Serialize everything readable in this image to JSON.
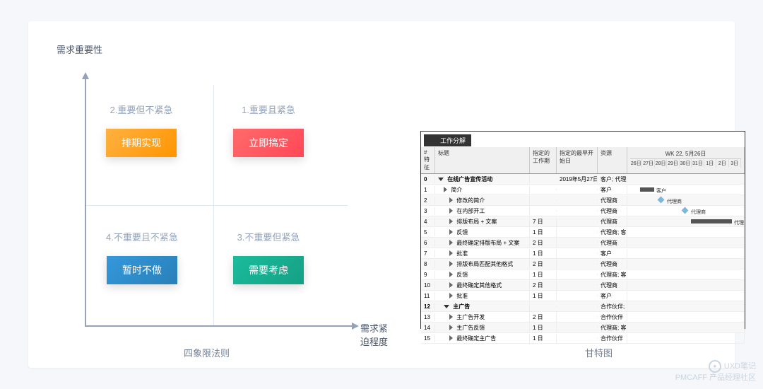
{
  "left": {
    "y_axis": "需求重要性",
    "x_axis": "需求紧迫程度",
    "caption": "四象限法则",
    "q1": {
      "label": "1.重要且紧急",
      "action": "立即搞定"
    },
    "q2": {
      "label": "2.重要但不紧急",
      "action": "排期实现"
    },
    "q3": {
      "label": "3.不重要但紧急",
      "action": "需要考虑"
    },
    "q4": {
      "label": "4.不重要且不紧急",
      "action": "暂时不做"
    }
  },
  "right": {
    "caption": "甘特图",
    "toolbar": "工作分解",
    "columns": {
      "idx": "# 特征",
      "title": "标题",
      "assigned": "指定的工作期",
      "start": "指定的最早开始日",
      "resource": "资源"
    },
    "week": "WK 22, 5月26日",
    "days": [
      "26日",
      "27日",
      "28日",
      "29日",
      "30日",
      "31日",
      "1日",
      "2日",
      "3日"
    ],
    "rows": [
      {
        "n": "0",
        "t": "在线广告宣传活动",
        "a": "",
        "b": "2019年5月27日",
        "r": "客户; 代理",
        "bold": true,
        "lvl": 0
      },
      {
        "n": "1",
        "t": "简介",
        "a": "",
        "b": "",
        "r": "客户",
        "lvl": 1,
        "bar": {
          "x": 18,
          "w": 20,
          "lbl": "客户"
        }
      },
      {
        "n": "2",
        "t": "修改的简介",
        "a": "",
        "b": "",
        "r": "代理商",
        "lvl": 2,
        "di": 44,
        "blbl": "代理商"
      },
      {
        "n": "3",
        "t": "在内部开工",
        "a": "",
        "b": "",
        "r": "代理商",
        "lvl": 2,
        "di": 78,
        "blbl": "代理商"
      },
      {
        "n": "4",
        "t": "排版布局 + 文案",
        "a": "7 日",
        "b": "",
        "r": "代理商",
        "lvl": 2,
        "bar": {
          "x": 90,
          "w": 58,
          "lbl": "代理商"
        }
      },
      {
        "n": "5",
        "t": "反馈",
        "a": "1 日",
        "b": "",
        "r": "代理商; 客",
        "lvl": 2
      },
      {
        "n": "6",
        "t": "最终确定排版布局 + 文案",
        "a": "2 日",
        "b": "",
        "r": "代理商",
        "lvl": 2
      },
      {
        "n": "7",
        "t": "批准",
        "a": "1 日",
        "b": "",
        "r": "客户",
        "lvl": 2
      },
      {
        "n": "8",
        "t": "排版布局匹配其他格式",
        "a": "2 日",
        "b": "",
        "r": "代理商",
        "lvl": 2
      },
      {
        "n": "9",
        "t": "反馈",
        "a": "1 日",
        "b": "",
        "r": "代理商; 客",
        "lvl": 2
      },
      {
        "n": "10",
        "t": "最终确定其他格式",
        "a": "2 日",
        "b": "",
        "r": "代理商",
        "lvl": 2
      },
      {
        "n": "11",
        "t": "批准",
        "a": "1 日",
        "b": "",
        "r": "客户",
        "lvl": 2
      },
      {
        "n": "12",
        "t": "主广告",
        "a": "",
        "b": "",
        "r": "合作伙伴;",
        "bold": true,
        "lvl": 1
      },
      {
        "n": "13",
        "t": "主广告开发",
        "a": "2 日",
        "b": "",
        "r": "合作伙伴",
        "lvl": 2
      },
      {
        "n": "14",
        "t": "主广告反馈",
        "a": "1 日",
        "b": "",
        "r": "代理商; 客",
        "lvl": 2
      },
      {
        "n": "15",
        "t": "最终确定主广告",
        "a": "1 日",
        "b": "",
        "r": "合作伙伴",
        "lvl": 2
      }
    ]
  },
  "watermark": {
    "line1": "UXD笔记",
    "line2": "PMCAFF 产品经理社区"
  }
}
